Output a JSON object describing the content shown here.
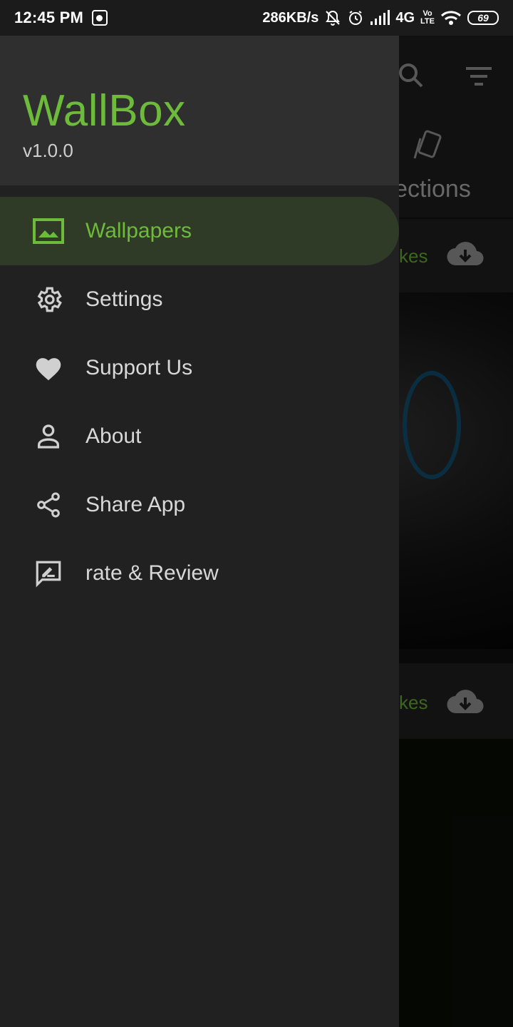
{
  "status_bar": {
    "time": "12:45 PM",
    "network_speed": "286KB/s",
    "network_type": "4G",
    "volte_line1": "Vo",
    "volte_line2": "LTE",
    "battery": "69"
  },
  "background": {
    "tab_label": "llections",
    "card1_likes": "kes",
    "card2_likes": "kes",
    "icons": [
      "search-icon",
      "filter-icon",
      "collections-icon",
      "cloud-download-icon"
    ]
  },
  "drawer": {
    "app_name": "WallBox",
    "version": "v1.0.0",
    "items": [
      {
        "label": "Wallpapers",
        "icon": "image-icon",
        "active": true
      },
      {
        "label": "Settings",
        "icon": "gear-icon",
        "active": false
      },
      {
        "label": "Support Us",
        "icon": "heart-icon",
        "active": false
      },
      {
        "label": "About",
        "icon": "person-icon",
        "active": false
      },
      {
        "label": "Share App",
        "icon": "share-icon",
        "active": false
      },
      {
        "label": "rate & Review",
        "icon": "rate-review-icon",
        "active": false
      }
    ]
  },
  "colors": {
    "accent": "#6dbb3a",
    "drawer_bg": "#212121",
    "header_bg": "#2f2f2f",
    "active_item_bg": "#2f3b27"
  }
}
